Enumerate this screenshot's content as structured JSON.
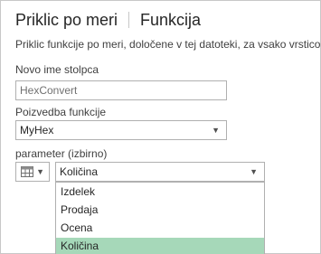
{
  "header": {
    "tab_custom": "Priklic po meri",
    "tab_function": "Funkcija"
  },
  "description": "Priklic funkcije po meri, določene v tej datoteki, za vsako vrstico.",
  "new_column": {
    "label": "Novo ime stolpca",
    "value": "HexConvert"
  },
  "function_query": {
    "label": "Poizvedba funkcije",
    "value": "MyHex"
  },
  "parameter": {
    "label": "parameter (izbirno)",
    "selected": "Količina",
    "icon": "table-icon",
    "options": [
      {
        "label": "Izdelek"
      },
      {
        "label": "Prodaja"
      },
      {
        "label": "Ocena"
      },
      {
        "label": "Količina",
        "selected": true
      }
    ]
  },
  "colors": {
    "selection": "#a6d8b9",
    "border": "#b0b0b0",
    "icon_green": "#6aa84f"
  }
}
